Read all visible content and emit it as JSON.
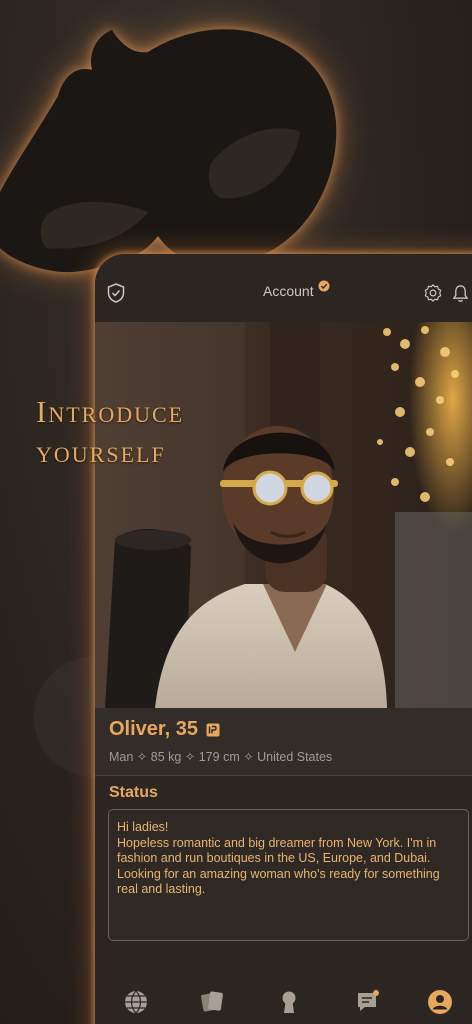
{
  "headline": {
    "line1": "Introduce",
    "line2": "yourself"
  },
  "header": {
    "title": "Account"
  },
  "profile": {
    "name_age": "Oliver, 35",
    "details": "Man ✧ 85 kg ✧ 179 cm ✧ United States"
  },
  "status": {
    "title": "Status",
    "text_line1": "Hi ladies!",
    "text_line2": "Hopeless romantic and big dreamer from New York. I'm in fashion and run boutiques in the US, Europe, and Dubai. Looking for an amazing woman who's ready for something real and lasting."
  },
  "nav": {
    "items": [
      "globe-icon",
      "cards-icon",
      "keyhole-icon",
      "chat-icon",
      "profile-icon"
    ]
  },
  "colors": {
    "accent": "#e8a75f",
    "background": "#2b2622",
    "glow": "#e0965a"
  }
}
